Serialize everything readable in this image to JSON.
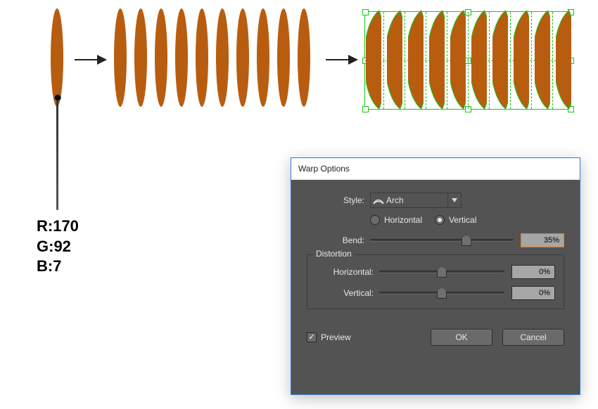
{
  "shape_color": "#b85d0f",
  "selection_color": "#17c61a",
  "rgb": {
    "r": "R:170",
    "g": "G:92",
    "b": "B:7"
  },
  "ellipse_count": 10,
  "dialog": {
    "title": "Warp Options",
    "style_label": "Style:",
    "style_value": "Arch",
    "orientation": {
      "horizontal_label": "Horizontal",
      "vertical_label": "Vertical",
      "selected": "vertical"
    },
    "bend": {
      "label": "Bend:",
      "value": "35%",
      "percent": 67
    },
    "distortion": {
      "legend": "Distortion",
      "horizontal": {
        "label": "Horizontal:",
        "value": "0%",
        "percent": 50
      },
      "vertical": {
        "label": "Vertical:",
        "value": "0%",
        "percent": 50
      }
    },
    "preview": {
      "label": "Preview",
      "checked": true
    },
    "ok_label": "OK",
    "cancel_label": "Cancel"
  }
}
